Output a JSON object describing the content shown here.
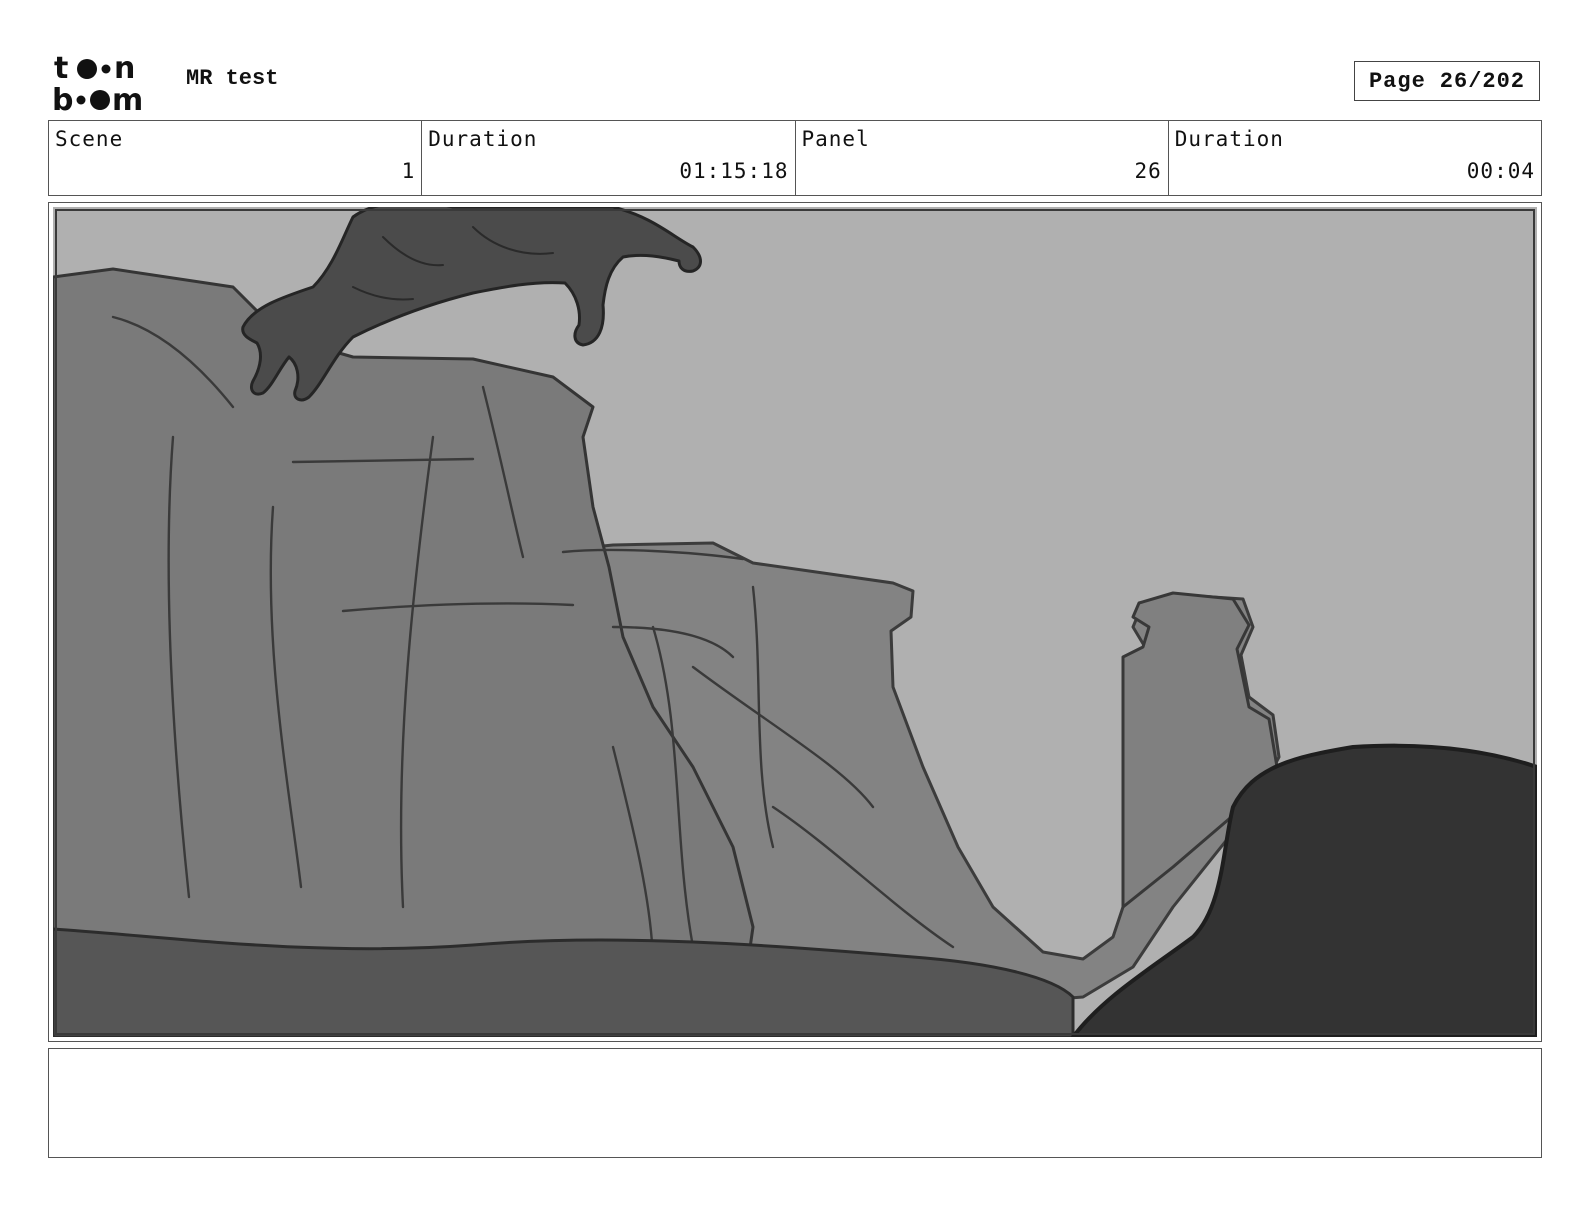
{
  "header": {
    "logo_text": "toon boom",
    "project_title": "MR test",
    "page_label": "Page",
    "page_number": "26/202"
  },
  "info": {
    "scene_label": "Scene",
    "scene_value": "1",
    "scene_duration_label": "Duration",
    "scene_duration_value": "01:15:18",
    "panel_label": "Panel",
    "panel_value": "26",
    "panel_duration_label": "Duration",
    "panel_duration_value": "00:04"
  },
  "notes": {
    "text": ""
  },
  "colors": {
    "sky": "#b0b0b0",
    "cliff": "#7c7c7c",
    "ground": "#575757",
    "foreground_rock": "#333333",
    "creature": "#4a4a4a"
  }
}
